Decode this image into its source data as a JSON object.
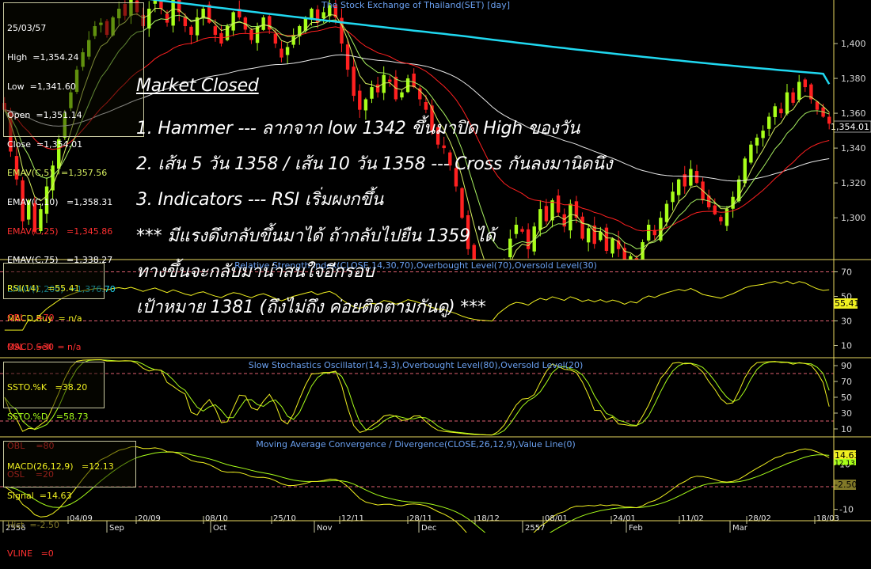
{
  "colors": {
    "background": "#000000",
    "up_candle": "#a8ff1a",
    "down_candle": "#ff2020",
    "ema5": "#d8f060",
    "ema10": "#a8f060",
    "ema25": "#ff2020",
    "ema75": "#e8e8e8",
    "ema200": "#20d8f0",
    "rsi": "#f0f020",
    "stoch_k": "#f0f020",
    "stoch_d": "#a8ff1a",
    "macd": "#f0f020",
    "signal": "#a8ff1a",
    "threshold": "#e06070",
    "panel_border": "#e8d860",
    "title_text": "#6aa0f0"
  },
  "info_box": {
    "date": "25/03/57",
    "high": "High  =1,354.24",
    "low": "Low  =1,341.60",
    "open": "Open  =1,351.14",
    "close": "Close  =1,354.01",
    "ema5": "EMAV(C,5)   =1,357.56",
    "ema10": "EMAV(C,10)   =1,358.31",
    "ema25": "EMAV(C,25)   =1,345.86",
    "ema75": "EMAV(C,75)   =1,338.27",
    "ema200": "EMAV(C,200)  =1,376.70",
    "macd_buy": "MACD.Buy  = n/a",
    "macd_sell": "MACD.Sell  = n/a"
  },
  "rsi_box": {
    "rsi": "RSI(14)   =55.41",
    "obl": "OBL    =70",
    "osl": "OSL    =30"
  },
  "stoch_box": {
    "k": "SSTO.%K   =38.20",
    "d": "SSTO.%D   =58.73",
    "obl": "OBL    =80",
    "osl": "OSL    =20"
  },
  "macd_box": {
    "macd": "MACD(26,12,9)   =12.13",
    "signal": "Signal  =14.63",
    "hist": "Hist  =-2.50",
    "vline": "VLINE   =0"
  },
  "annotation": {
    "title": "Market Closed",
    "line1": "1. Hammer --- ลากจาก low 1342 ขึ้นมาปิด High ของวัน",
    "line2": "2. เส้น 5 วัน 1358 / เส้น 10 วัน 1358 ---  Cross กันลงมานิดนึง",
    "line3": "3. Indicators --- RSI เริ่มผงกขึ้น",
    "line4": "*** มีแรงดึงกลับขึ้นมาได้ ถ้ากลับไปยืน 1359 ได้",
    "line5": "ทางขึ้นจะกลับมาน่าสนใจอีกรอบ",
    "line6": "เป้าหมาย 1381 (ถึงไม่ถึง ค่อยติดตามกันดู) ***"
  },
  "chart_data": [
    {
      "type": "candlestick",
      "title": "The Stock Exchange of Thailand(SET) [day]",
      "ylim": [
        1276,
        1425
      ],
      "y_ticks": [
        1300,
        1320,
        1340,
        1360,
        1380,
        1400
      ],
      "last_price_label": "1,354.01",
      "x_month_labels": [
        "2556",
        "Sep",
        "Oct",
        "Nov",
        "Dec",
        "2557",
        "Feb",
        "Mar"
      ],
      "x_date_labels": [
        "04/09",
        "20/09",
        "08/10",
        "25/10",
        "12/11",
        "28/11",
        "18/12",
        "08/01",
        "24/01",
        "11/02",
        "28/02",
        "18/03"
      ],
      "close": [
        1362,
        1338,
        1322,
        1298,
        1310,
        1292,
        1305,
        1318,
        1330,
        1345,
        1360,
        1372,
        1385,
        1395,
        1402,
        1410,
        1412,
        1405,
        1415,
        1420,
        1416,
        1425,
        1418,
        1410,
        1420,
        1428,
        1420,
        1412,
        1425,
        1418,
        1410,
        1405,
        1415,
        1420,
        1412,
        1405,
        1400,
        1410,
        1418,
        1415,
        1408,
        1402,
        1410,
        1415,
        1408,
        1400,
        1392,
        1398,
        1405,
        1410,
        1415,
        1420,
        1412,
        1418,
        1422,
        1415,
        1400,
        1385,
        1370,
        1362,
        1368,
        1375,
        1372,
        1382,
        1378,
        1368,
        1372,
        1380,
        1375,
        1368,
        1362,
        1350,
        1342,
        1340,
        1330,
        1318,
        1300,
        1282,
        1268,
        1258,
        1252,
        1245,
        1262,
        1275,
        1288,
        1296,
        1292,
        1282,
        1295,
        1305,
        1298,
        1310,
        1303,
        1295,
        1308,
        1300,
        1288,
        1294,
        1285,
        1292,
        1281,
        1288,
        1282,
        1270,
        1278,
        1272,
        1286,
        1296,
        1290,
        1300,
        1308,
        1315,
        1322,
        1318,
        1328,
        1320,
        1310,
        1306,
        1302,
        1298,
        1305,
        1312,
        1322,
        1334,
        1342,
        1346,
        1350,
        1358,
        1364,
        1360,
        1372,
        1366,
        1378,
        1375,
        1368,
        1362,
        1358,
        1354
      ],
      "ema200_end": 1376.7
    },
    {
      "type": "line",
      "title": "Relative Strength Index(CLOSE,14,30,70),Overbought Level(70),Oversold Level(30)",
      "ylim": [
        0,
        80
      ],
      "y_ticks": [
        10,
        30,
        50,
        70
      ],
      "last_value_label": "55.41",
      "levels": [
        70,
        30
      ],
      "rsi_end": 55.41
    },
    {
      "type": "line",
      "title": "Slow Stochastics Oscillator(14,3,3),Overbought Level(80),Oversold Level(20)",
      "ylim": [
        0,
        100
      ],
      "y_ticks": [
        10,
        30,
        50,
        70,
        90
      ],
      "levels": [
        80,
        20
      ],
      "k_end": 38.2,
      "d_end": 58.73
    },
    {
      "type": "line",
      "title": "Moving Average Convergence / Divergence(CLOSE,26,12,9),Value Line(0)",
      "ylim": [
        -15,
        22
      ],
      "y_ticks": [
        -10,
        0,
        10
      ],
      "levels": [
        0
      ],
      "labels": {
        "macd": "12.13",
        "signal": "14.63",
        "hist": "-2.50"
      }
    }
  ]
}
